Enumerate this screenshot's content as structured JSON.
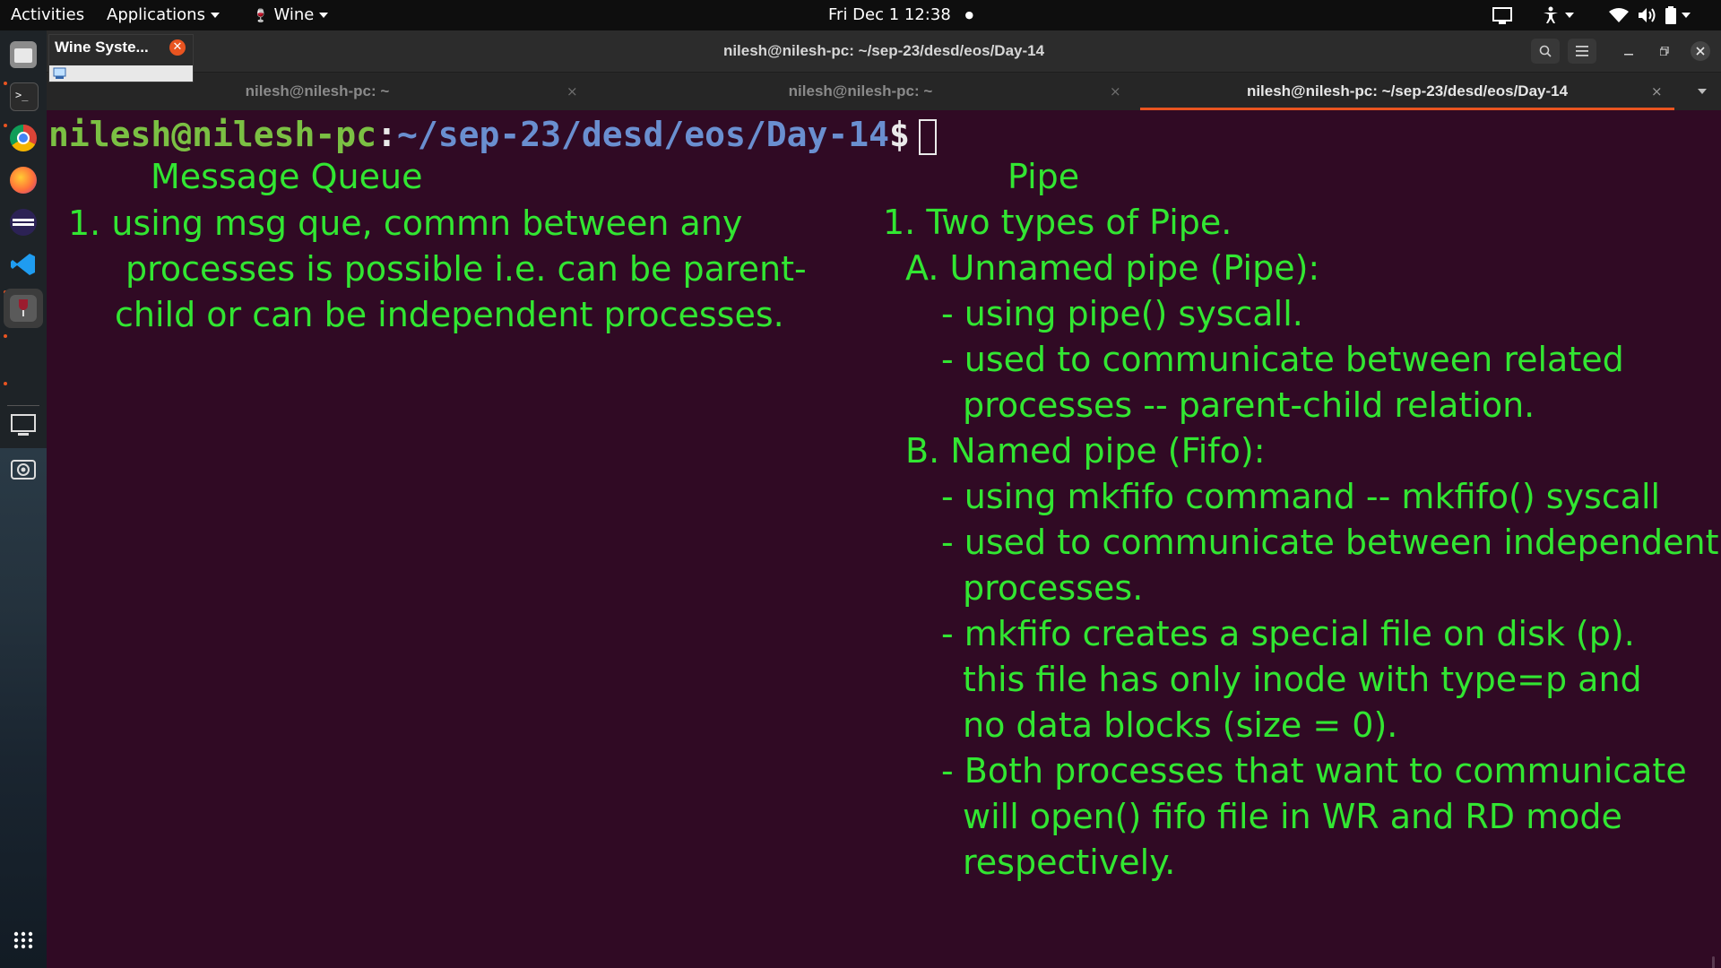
{
  "topbar": {
    "activities": "Activities",
    "applications": "Applications",
    "wine_menu": "Wine",
    "clock": "Fri Dec 1  12:38",
    "clock_dot": "●"
  },
  "wine_popup": {
    "title": "Wine Syste...",
    "close": "✕"
  },
  "window": {
    "title": "nilesh@nilesh-pc: ~/sep-23/desd/eos/Day-14",
    "tabs": [
      {
        "label": "nilesh@nilesh-pc: ~",
        "active": false
      },
      {
        "label": "nilesh@nilesh-pc: ~",
        "active": false
      },
      {
        "label": "nilesh@nilesh-pc: ~/sep-23/desd/eos/Day-14",
        "active": true
      }
    ],
    "tab_close": "×"
  },
  "terminal": {
    "prompt_user": "nilesh@nilesh-pc",
    "prompt_sep": ":",
    "prompt_path": "~/sep-23/desd/eos/Day-14",
    "prompt_symbol": "$"
  },
  "notes": {
    "left_heading": "Message Queue",
    "left_lines": [
      "1. using msg que, commn between any",
      "processes is possible i.e. can be parent-",
      "child or can be independent processes."
    ],
    "right_heading": "Pipe",
    "right_lines": [
      "1. Two types of Pipe.",
      "A. Unnamed pipe (Pipe):",
      "- using pipe() syscall.",
      "- used to communicate between related",
      "processes -- parent-child relation.",
      "B. Named pipe (Fifo):",
      "- using mkfifo command -- mkfifo() syscall",
      "- used to communicate between independent",
      "processes.",
      "- mkfifo creates a special file on disk (p).",
      "this file has only inode with type=p and",
      "no data blocks (size = 0).",
      "- Both processes that want to communicate",
      "will open() fifo file in WR and RD mode",
      "respectively."
    ]
  },
  "colors": {
    "terminal_bg": "#300a24",
    "note_text": "#32e632",
    "accent": "#e95420",
    "prompt_user": "#7bc043",
    "prompt_path": "#6a8fd0"
  },
  "icons": {
    "dock": [
      "files-icon",
      "terminal-icon",
      "chrome-icon",
      "firefox-icon",
      "eclipse-icon",
      "vscode-icon",
      "wine-icon",
      "display-icon",
      "screenshot-icon",
      "app-grid-icon"
    ],
    "tray": [
      "screen-icon",
      "accessibility-icon",
      "wifi-icon",
      "volume-icon",
      "battery-icon"
    ]
  }
}
